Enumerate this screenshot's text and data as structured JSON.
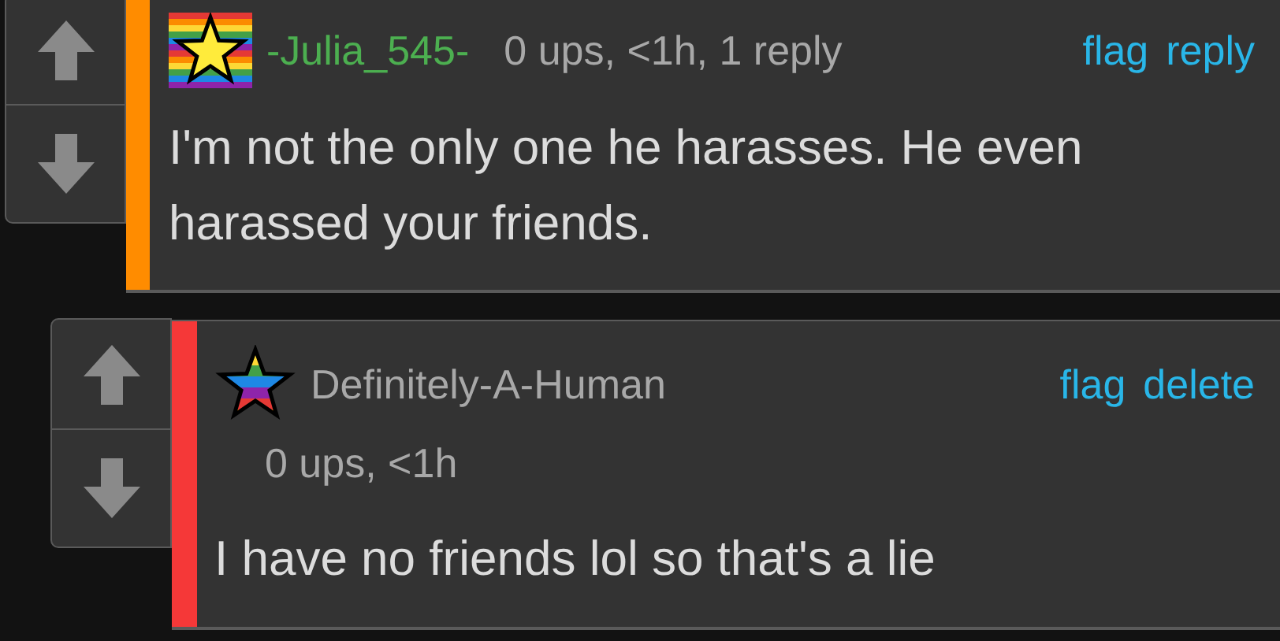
{
  "comments": [
    {
      "color": "#ff8c00",
      "avatar": {
        "kind": "square"
      },
      "username": "-Julia_545-",
      "highlighted": true,
      "meta": "0 ups, <1h, 1 reply",
      "meta_inline": true,
      "actions": [
        "flag",
        "reply"
      ],
      "body": "I'm not the only one he harasses. He even harassed your friends.",
      "reply": false
    },
    {
      "color": "#f53838",
      "avatar": {
        "kind": "star"
      },
      "username": "Definitely-A-Human",
      "highlighted": false,
      "meta": "0 ups, <1h",
      "meta_inline": false,
      "actions": [
        "flag",
        "delete"
      ],
      "body": "I have no friends lol so that's a lie",
      "reply": true
    }
  ]
}
